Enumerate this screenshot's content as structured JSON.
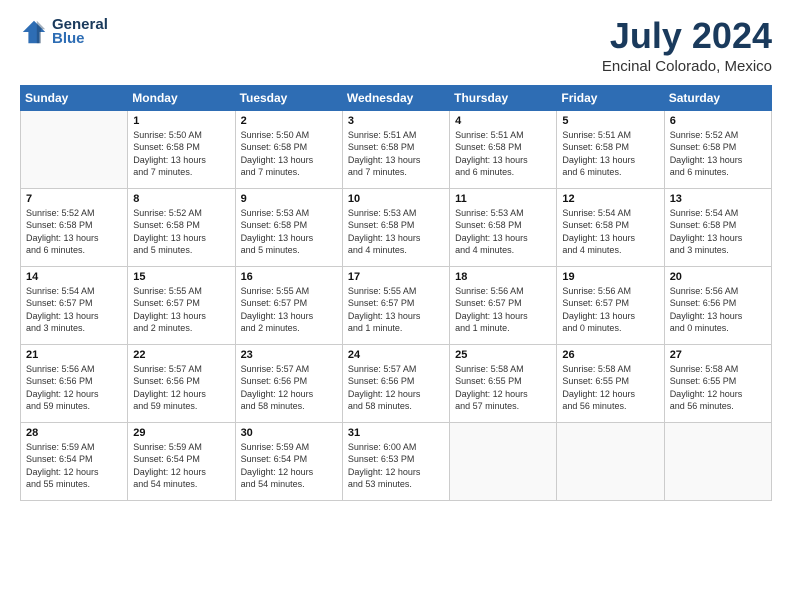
{
  "header": {
    "logo_line1": "General",
    "logo_line2": "Blue",
    "main_title": "July 2024",
    "sub_title": "Encinal Colorado, Mexico"
  },
  "columns": [
    "Sunday",
    "Monday",
    "Tuesday",
    "Wednesday",
    "Thursday",
    "Friday",
    "Saturday"
  ],
  "weeks": [
    [
      {
        "day": "",
        "info": ""
      },
      {
        "day": "1",
        "info": "Sunrise: 5:50 AM\nSunset: 6:58 PM\nDaylight: 13 hours\nand 7 minutes."
      },
      {
        "day": "2",
        "info": "Sunrise: 5:50 AM\nSunset: 6:58 PM\nDaylight: 13 hours\nand 7 minutes."
      },
      {
        "day": "3",
        "info": "Sunrise: 5:51 AM\nSunset: 6:58 PM\nDaylight: 13 hours\nand 7 minutes."
      },
      {
        "day": "4",
        "info": "Sunrise: 5:51 AM\nSunset: 6:58 PM\nDaylight: 13 hours\nand 6 minutes."
      },
      {
        "day": "5",
        "info": "Sunrise: 5:51 AM\nSunset: 6:58 PM\nDaylight: 13 hours\nand 6 minutes."
      },
      {
        "day": "6",
        "info": "Sunrise: 5:52 AM\nSunset: 6:58 PM\nDaylight: 13 hours\nand 6 minutes."
      }
    ],
    [
      {
        "day": "7",
        "info": "Sunrise: 5:52 AM\nSunset: 6:58 PM\nDaylight: 13 hours\nand 6 minutes."
      },
      {
        "day": "8",
        "info": "Sunrise: 5:52 AM\nSunset: 6:58 PM\nDaylight: 13 hours\nand 5 minutes."
      },
      {
        "day": "9",
        "info": "Sunrise: 5:53 AM\nSunset: 6:58 PM\nDaylight: 13 hours\nand 5 minutes."
      },
      {
        "day": "10",
        "info": "Sunrise: 5:53 AM\nSunset: 6:58 PM\nDaylight: 13 hours\nand 4 minutes."
      },
      {
        "day": "11",
        "info": "Sunrise: 5:53 AM\nSunset: 6:58 PM\nDaylight: 13 hours\nand 4 minutes."
      },
      {
        "day": "12",
        "info": "Sunrise: 5:54 AM\nSunset: 6:58 PM\nDaylight: 13 hours\nand 4 minutes."
      },
      {
        "day": "13",
        "info": "Sunrise: 5:54 AM\nSunset: 6:58 PM\nDaylight: 13 hours\nand 3 minutes."
      }
    ],
    [
      {
        "day": "14",
        "info": "Sunrise: 5:54 AM\nSunset: 6:57 PM\nDaylight: 13 hours\nand 3 minutes."
      },
      {
        "day": "15",
        "info": "Sunrise: 5:55 AM\nSunset: 6:57 PM\nDaylight: 13 hours\nand 2 minutes."
      },
      {
        "day": "16",
        "info": "Sunrise: 5:55 AM\nSunset: 6:57 PM\nDaylight: 13 hours\nand 2 minutes."
      },
      {
        "day": "17",
        "info": "Sunrise: 5:55 AM\nSunset: 6:57 PM\nDaylight: 13 hours\nand 1 minute."
      },
      {
        "day": "18",
        "info": "Sunrise: 5:56 AM\nSunset: 6:57 PM\nDaylight: 13 hours\nand 1 minute."
      },
      {
        "day": "19",
        "info": "Sunrise: 5:56 AM\nSunset: 6:57 PM\nDaylight: 13 hours\nand 0 minutes."
      },
      {
        "day": "20",
        "info": "Sunrise: 5:56 AM\nSunset: 6:56 PM\nDaylight: 13 hours\nand 0 minutes."
      }
    ],
    [
      {
        "day": "21",
        "info": "Sunrise: 5:56 AM\nSunset: 6:56 PM\nDaylight: 12 hours\nand 59 minutes."
      },
      {
        "day": "22",
        "info": "Sunrise: 5:57 AM\nSunset: 6:56 PM\nDaylight: 12 hours\nand 59 minutes."
      },
      {
        "day": "23",
        "info": "Sunrise: 5:57 AM\nSunset: 6:56 PM\nDaylight: 12 hours\nand 58 minutes."
      },
      {
        "day": "24",
        "info": "Sunrise: 5:57 AM\nSunset: 6:56 PM\nDaylight: 12 hours\nand 58 minutes."
      },
      {
        "day": "25",
        "info": "Sunrise: 5:58 AM\nSunset: 6:55 PM\nDaylight: 12 hours\nand 57 minutes."
      },
      {
        "day": "26",
        "info": "Sunrise: 5:58 AM\nSunset: 6:55 PM\nDaylight: 12 hours\nand 56 minutes."
      },
      {
        "day": "27",
        "info": "Sunrise: 5:58 AM\nSunset: 6:55 PM\nDaylight: 12 hours\nand 56 minutes."
      }
    ],
    [
      {
        "day": "28",
        "info": "Sunrise: 5:59 AM\nSunset: 6:54 PM\nDaylight: 12 hours\nand 55 minutes."
      },
      {
        "day": "29",
        "info": "Sunrise: 5:59 AM\nSunset: 6:54 PM\nDaylight: 12 hours\nand 54 minutes."
      },
      {
        "day": "30",
        "info": "Sunrise: 5:59 AM\nSunset: 6:54 PM\nDaylight: 12 hours\nand 54 minutes."
      },
      {
        "day": "31",
        "info": "Sunrise: 6:00 AM\nSunset: 6:53 PM\nDaylight: 12 hours\nand 53 minutes."
      },
      {
        "day": "",
        "info": ""
      },
      {
        "day": "",
        "info": ""
      },
      {
        "day": "",
        "info": ""
      }
    ]
  ]
}
